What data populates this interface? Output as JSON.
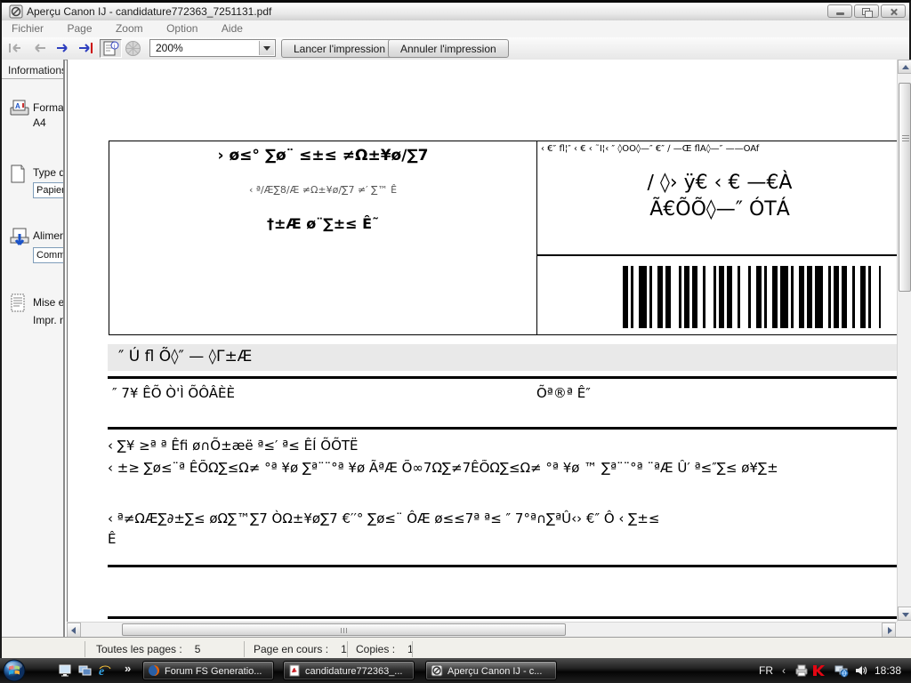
{
  "colors": {
    "nav_arrow_blue": "#2e3fbf",
    "nav_bar_red": "#cc0000",
    "kaspersky_red": "#e30613",
    "firefox_orange": "#e66000",
    "ie_blue": "#30a7e8",
    "feed_arrow_blue": "#1b53c8",
    "doc_grayband": "#e9e9e9"
  },
  "window": {
    "title": "Aperçu Canon IJ - candidature772363_7251131.pdf"
  },
  "menu": {
    "items": [
      "Fichier",
      "Page",
      "Zoom",
      "Option",
      "Aide"
    ]
  },
  "toolbar": {
    "zoom_value": "200%",
    "print_label": "Lancer l'impression",
    "cancel_label": "Annuler l'impression"
  },
  "sidebar": {
    "header": "Informations d",
    "format_label": "Format",
    "format_value": "A4",
    "media_label": "Type d",
    "media_value": "Papier",
    "source_label": "Aliment",
    "source_value": "Comm",
    "layout_label": "Mise en",
    "layout_value": "Impr. no"
  },
  "document": {
    "left_box": {
      "line1": "› ø≤° ∑ø¨ ≤±≤ ≠Ω±¥ø∕∑7",
      "line2": "‹ ª∕Æ∑8∕Æ ≠Ω±¥ø∕∑7 ≠′ ∑™ Ê",
      "line3": "†±Æ ø¨∑±≤ Ê˜"
    },
    "right_box": {
      "small_line": "‹ €″ fl¦″ ‹ € ‹ ˜Ï¦‹ ″ ◊ÕÕ◊—″ €″ ∕ —Œ flÁ◊—″ ——ÕÃf",
      "big_line1": "∕ ◊› ÿ€ ‹ €  —€À",
      "big_line2": "Ã€ÕÕ◊—″ ÓΤÁ"
    },
    "barcode_pattern": "211231122123112122131121221312211221311221213211212212211311222113122121",
    "section_header": "″  Ú  fl Õ◊″  —  ◊Γ±Æ",
    "row1_left": "″ 7¥ ÊÕ Ò'Ì ÕÔÂÈÈ",
    "row1_right": "Õª®ª Ê″",
    "para1_line1": "‹ ∑¥ ≥ª ª Êfi ø∩Õ±æë ª≤′ ª≤ ÊÍ ÕÕΤË",
    "para1_line2": "‹ ±≥ ∑ø≤¨ª ÊÕΩ∑≤Ω≠ °ª ¥ø  ∑ª¨¨°ª ¥ø ÃªÆ  Õ∞7Ω∑≠7ÊÕΩ∑≤Ω≠ °ª ¥ø ™  ∑ª¨¨°ª ¨ªÆ  Û′  ª≤″∑≤ ø¥∑±",
    "para2_line1": "‹ ª≠ΩÆ∑∂±∑≤ øΩ∑™∑7 ÒΩ±¥ø∑7 €′′° ∑ø≤¨  ÔÆ ø≤≤7ª ª≤ ″  7°ª∩∑ªÛ‹› €″  Ô ‹ ∑±≤",
    "para2_line2": "Ê"
  },
  "statusbar": {
    "total_label": "Toutes les pages :",
    "total_value": "5",
    "current_label": "Page en cours :",
    "current_value": "1",
    "copies_label": "Copies :",
    "copies_value": "1"
  },
  "taskbar": {
    "more_chevron": "»",
    "buttons": [
      {
        "label": "Forum FS Generatio..."
      },
      {
        "label": "candidature772363_..."
      },
      {
        "label": "Aperçu Canon IJ - c..."
      }
    ],
    "tray": {
      "lang": "FR",
      "collapse": "‹",
      "time": "18:38"
    }
  }
}
